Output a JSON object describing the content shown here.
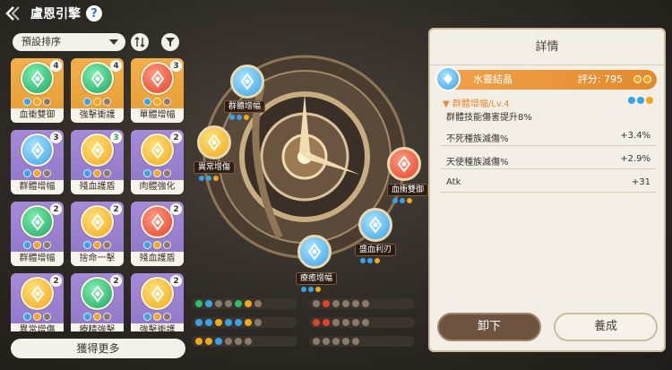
{
  "header": {
    "title": "盧恩引擎",
    "help": "?"
  },
  "toolbar": {
    "sort_label": "預設排序"
  },
  "colors": {
    "orange_card": "#f0a742",
    "purple_card": "#9b82d2",
    "accent": "#e58a35"
  },
  "cards": [
    {
      "label": "血衝雙御",
      "count": "4",
      "color": "orange",
      "orb": "green"
    },
    {
      "label": "強擊衝護",
      "count": "4",
      "color": "orange",
      "orb": "green"
    },
    {
      "label": "單體增幅",
      "count": "3",
      "color": "orange",
      "orb": "red"
    },
    {
      "label": "群體增幅",
      "count": "3",
      "color": "purple",
      "orb": "blue"
    },
    {
      "label": "殘血護盾",
      "count": "3",
      "color": "purple",
      "orb": "yellow"
    },
    {
      "label": "肉體強化",
      "count": "2",
      "color": "purple",
      "orb": "yellow"
    },
    {
      "label": "群體增幅",
      "count": "2",
      "color": "purple",
      "orb": "green"
    },
    {
      "label": "捨命一擊",
      "count": "2",
      "color": "purple",
      "orb": "yellow"
    },
    {
      "label": "殘血護盾",
      "count": "2",
      "color": "purple",
      "orb": "red"
    },
    {
      "label": "異常增傷",
      "count": "2",
      "color": "purple",
      "orb": "yellow"
    },
    {
      "label": "療精強擊",
      "count": "2",
      "color": "purple",
      "orb": "green"
    },
    {
      "label": "強擊衝護",
      "count": "2",
      "color": "purple",
      "orb": "yellow"
    }
  ],
  "get_more": "獲得更多",
  "machine": {
    "nodes": [
      {
        "label": "群體增幅",
        "orb": "blue"
      },
      {
        "label": "異常增傷",
        "orb": "yellow"
      },
      {
        "label": "血衝雙御",
        "orb": "red"
      },
      {
        "label": "盛血利刃",
        "orb": "blue"
      },
      {
        "label": "療癒增幅",
        "orb": "blue"
      }
    ]
  },
  "detail": {
    "title": "詳情",
    "gem_name": "水靈結晶",
    "score": "評分: 795",
    "skill": "群體增幅/Lv.4",
    "skill_desc": "群體技能傷害提升8%",
    "stats": [
      {
        "name": "不死種族滅傷%",
        "value": "+3.4%"
      },
      {
        "name": "天使種族滅傷%",
        "value": "+2.9%"
      },
      {
        "name": "Atk",
        "value": "+31"
      }
    ],
    "unequip": "卸下",
    "cultivate": "養成"
  }
}
